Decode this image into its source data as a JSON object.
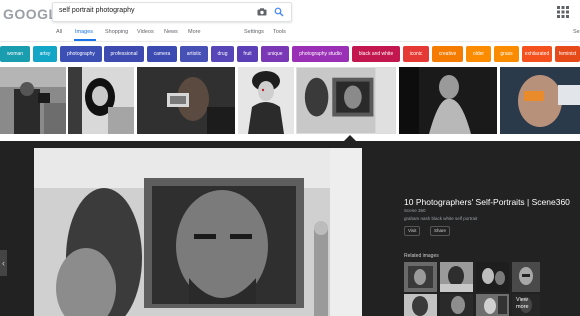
{
  "logo": {
    "text": "GOOGLE"
  },
  "search": {
    "query": "self portrait photography"
  },
  "tabs": [
    {
      "label": "All"
    },
    {
      "label": "Images"
    },
    {
      "label": "Shopping"
    },
    {
      "label": "Videos"
    },
    {
      "label": "News"
    },
    {
      "label": "More"
    },
    {
      "label": "Settings"
    },
    {
      "label": "Tools"
    }
  ],
  "tab_edge_text": "Se",
  "chips": [
    {
      "label": "woman",
      "color": "#1a9dae"
    },
    {
      "label": "artsy",
      "color": "#14a6c7"
    },
    {
      "label": "photography",
      "color": "#3c4fb5"
    },
    {
      "label": "professional",
      "color": "#3d4bb0"
    },
    {
      "label": "camera",
      "color": "#3c4bb2"
    },
    {
      "label": "artistic",
      "color": "#4650b5"
    },
    {
      "label": "drug",
      "color": "#5646b8"
    },
    {
      "label": "fruit",
      "color": "#5a3fb7"
    },
    {
      "label": "unique",
      "color": "#7a38b6"
    },
    {
      "label": "photography studio",
      "color": "#9a30b5"
    },
    {
      "label": "black and white",
      "color": "#c2184f"
    },
    {
      "label": "iconic",
      "color": "#e53935"
    },
    {
      "label": "creative",
      "color": "#f57c00"
    },
    {
      "label": "older",
      "color": "#fb8c00"
    },
    {
      "label": "grass",
      "color": "#fb8c00"
    },
    {
      "label": "exhilarated",
      "color": "#f4511e"
    },
    {
      "label": "feminist",
      "color": "#e64a19"
    }
  ],
  "result": {
    "title": "10 Photographers' Self-Portraits | Scene360",
    "source": "Scene 360",
    "description": "graham nash black white self portrait",
    "visit_label": "Visit",
    "share_label": "Share",
    "related_label": "Related images",
    "view_more_label": "View more"
  },
  "icons": {
    "camera": "camera-icon",
    "search": "search-icon",
    "apps": "apps-grid-icon",
    "prev": "chevron-left-icon"
  },
  "colors": {
    "accent": "#1a73e8",
    "panel": "#222222"
  }
}
